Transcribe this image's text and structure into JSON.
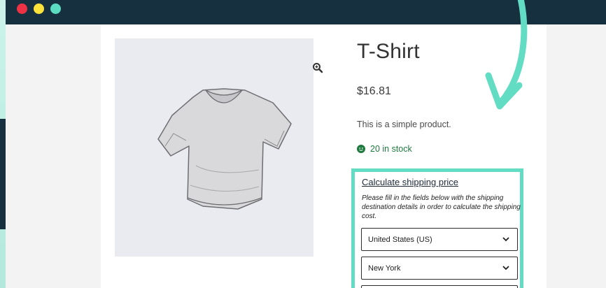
{
  "window": {
    "controls": [
      "close",
      "minimize",
      "maximize"
    ]
  },
  "product": {
    "title": "T-Shirt",
    "price": "$16.81",
    "description": "This is a simple product.",
    "stock": "20 in stock",
    "image_icon": "tshirt-image",
    "zoom_icon": "zoom-in-icon"
  },
  "shipping": {
    "title": "Calculate shipping price",
    "help": "Please fill in the fields below with the shipping destination details in order to calculate the shipping cost.",
    "country": "United States (US)",
    "state": "New York",
    "third": ""
  },
  "colors": {
    "titlebar": "#16303f",
    "accent": "#62dcc2",
    "stock": "#1f7a3f",
    "close": "#ec3244",
    "minimize": "#fbe33b",
    "maximize": "#5bdbc0"
  }
}
